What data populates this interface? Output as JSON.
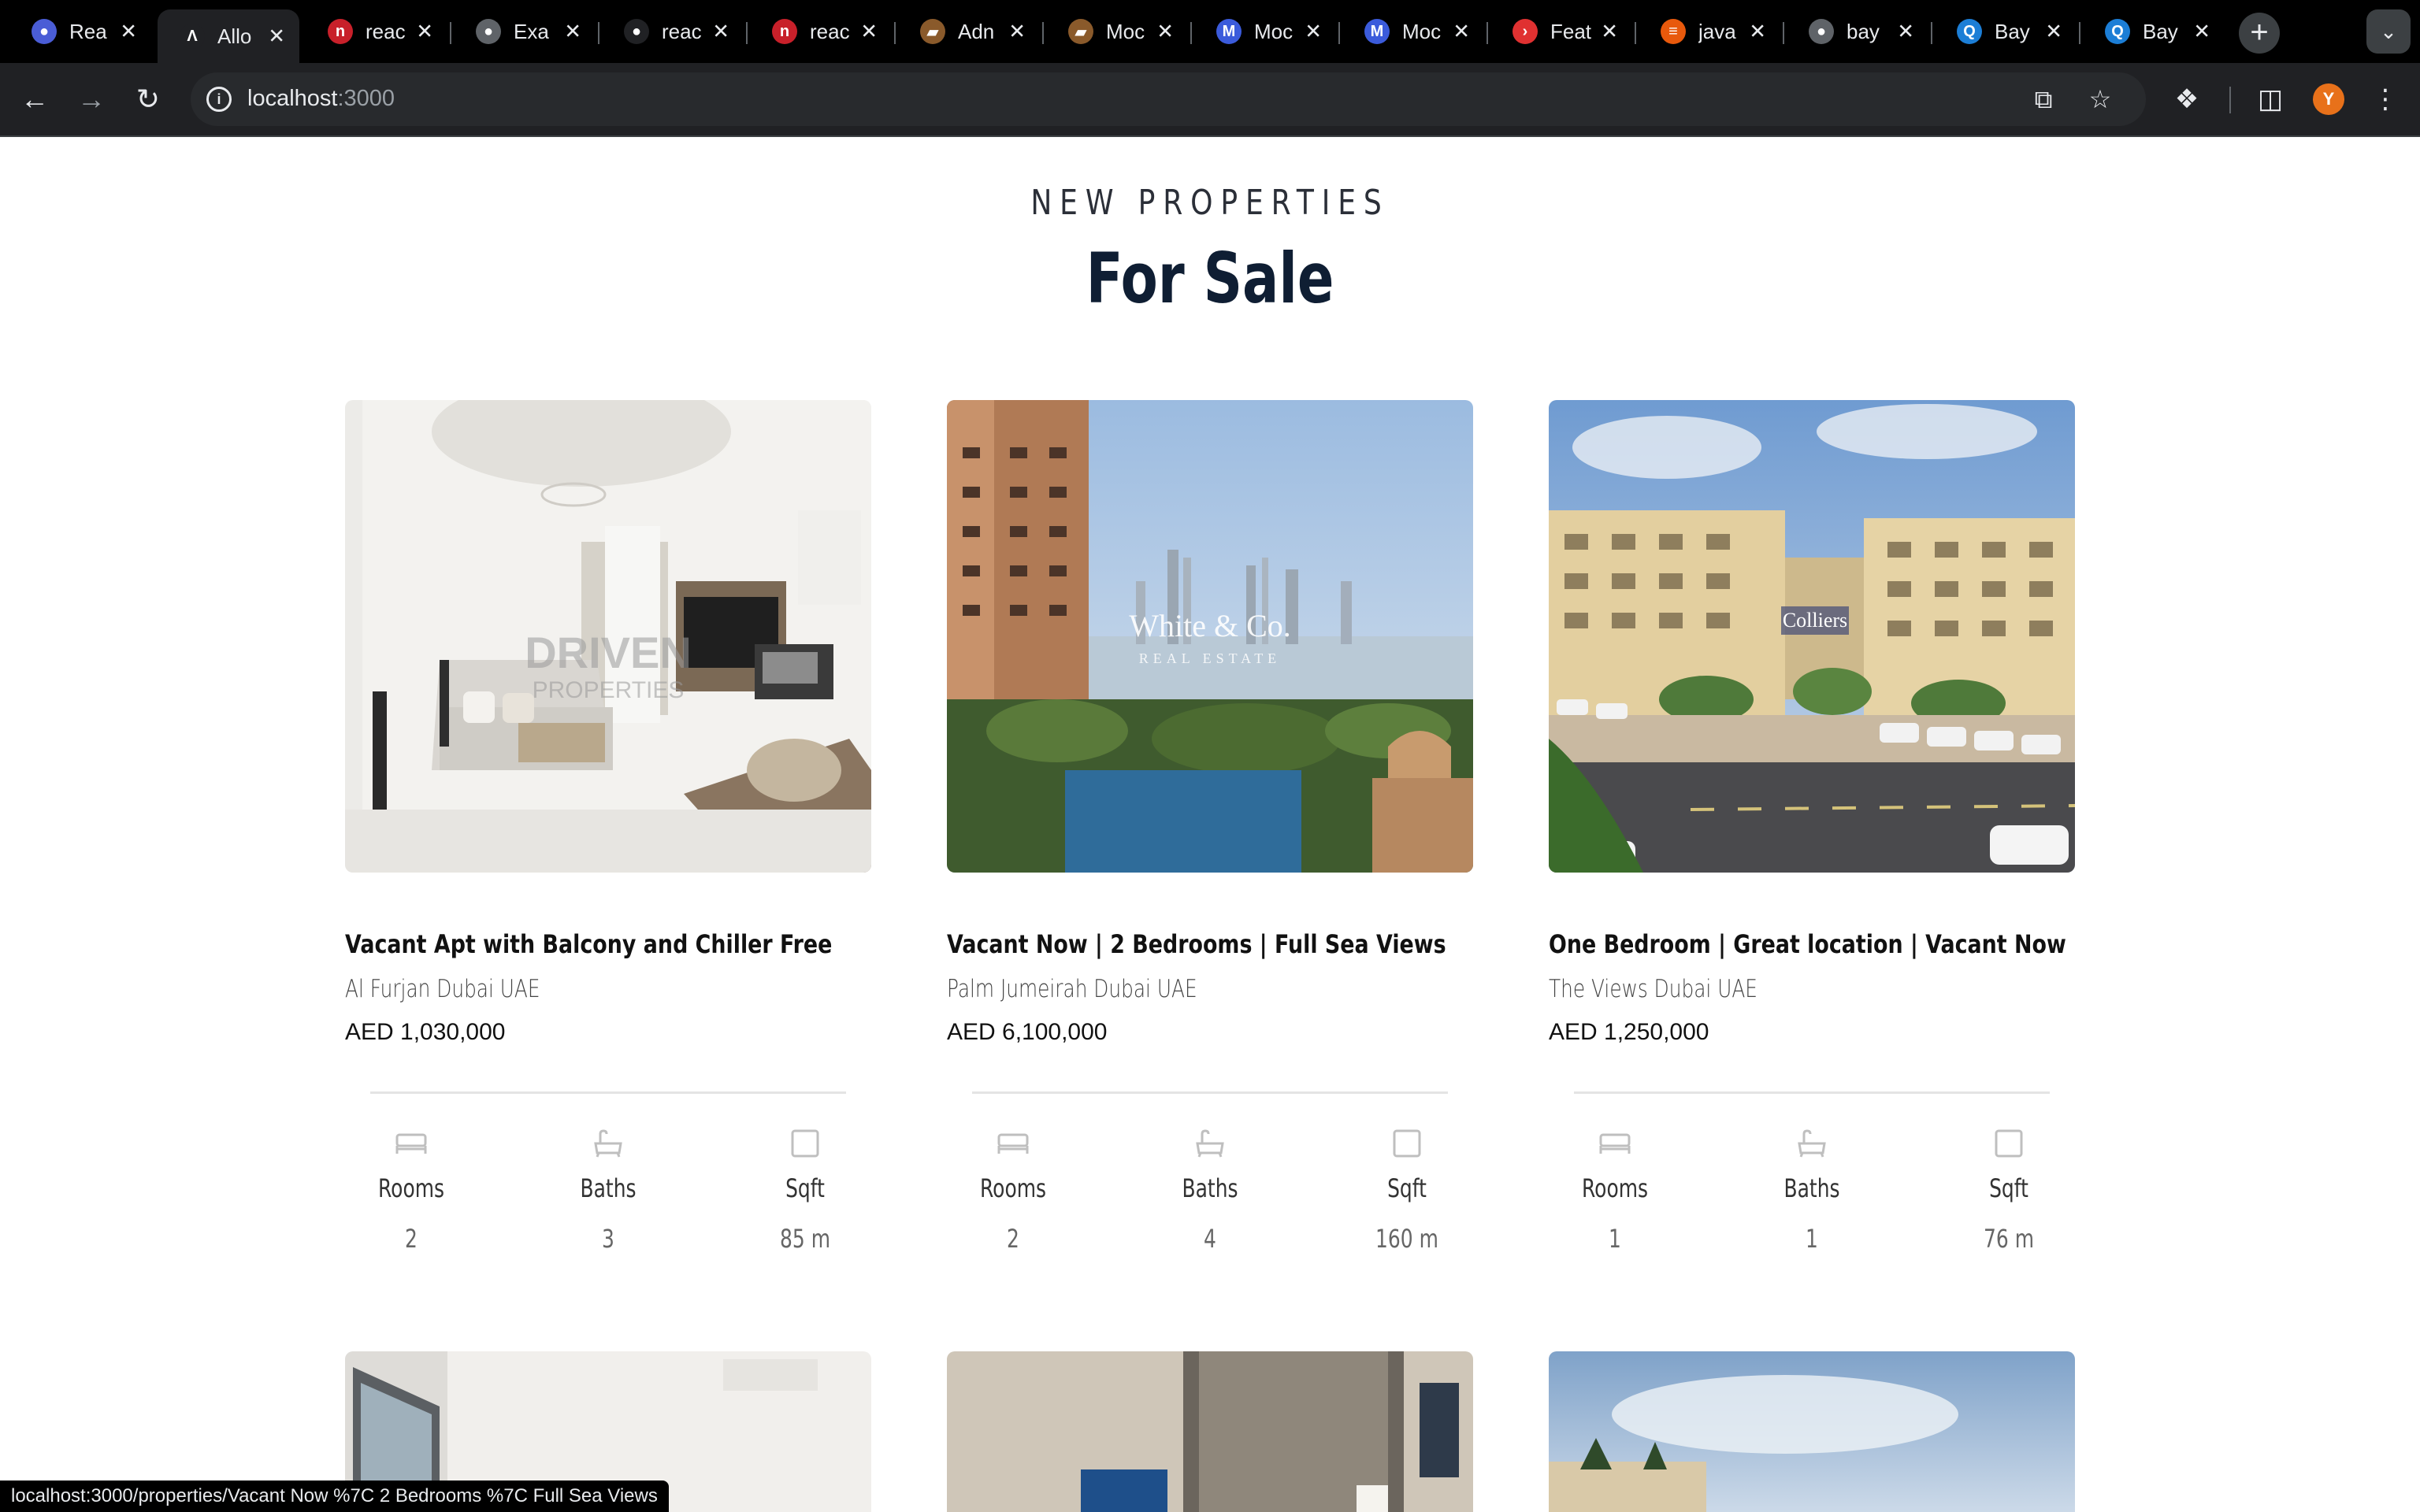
{
  "browser": {
    "tabs": [
      {
        "title": "Rea",
        "fav_color": "#4a5dd6",
        "fav_text": "●"
      },
      {
        "title": "Allo",
        "fav_color": "#202124",
        "fav_text": "Λ"
      },
      {
        "title": "reac",
        "fav_color": "#c8202a",
        "fav_text": "n"
      },
      {
        "title": "Exa",
        "fav_color": "#5f6368",
        "fav_text": "●"
      },
      {
        "title": "reac",
        "fav_color": "#202124",
        "fav_text": "●"
      },
      {
        "title": "reac",
        "fav_color": "#c8202a",
        "fav_text": "n"
      },
      {
        "title": "Adn",
        "fav_color": "#8a5a2b",
        "fav_text": "▰"
      },
      {
        "title": "Moc",
        "fav_color": "#8a5a2b",
        "fav_text": "▰"
      },
      {
        "title": "Moc",
        "fav_color": "#3b5bdb",
        "fav_text": "M"
      },
      {
        "title": "Moc",
        "fav_color": "#3b5bdb",
        "fav_text": "M"
      },
      {
        "title": "Feat",
        "fav_color": "#e03131",
        "fav_text": "›"
      },
      {
        "title": "java",
        "fav_color": "#e8590c",
        "fav_text": "≡"
      },
      {
        "title": "bay",
        "fav_color": "#5f6368",
        "fav_text": "●"
      },
      {
        "title": "Bay",
        "fav_color": "#1c7ed6",
        "fav_text": "Q"
      },
      {
        "title": "Bay",
        "fav_color": "#1c7ed6",
        "fav_text": "Q"
      }
    ],
    "active_tab_index": 1,
    "address": {
      "host": "localhost",
      "port": ":3000"
    },
    "profile_initial": "Y",
    "status_url": "localhost:3000/properties/Vacant Now %7C 2 Bedrooms %7C Full Sea Views"
  },
  "section": {
    "eyebrow": "NEW PROPERTIES",
    "title": "For Sale"
  },
  "feature_labels": {
    "rooms": "Rooms",
    "baths": "Baths",
    "sqft": "Sqft"
  },
  "properties": [
    {
      "title": "Vacant Apt with Balcony and Chiller Free",
      "location": "Al Furjan Dubai UAE",
      "price": "AED 1,030,000",
      "rooms": "2",
      "baths": "3",
      "sqft": "85 m",
      "watermark": "DRIVEN",
      "watermark_sub": "PROPERTIES"
    },
    {
      "title": "Vacant Now | 2 Bedrooms | Full Sea Views",
      "location": "Palm Jumeirah Dubai UAE",
      "price": "AED 6,100,000",
      "rooms": "2",
      "baths": "4",
      "sqft": "160 m",
      "watermark": "White & Co.",
      "watermark_sub": "REAL ESTATE"
    },
    {
      "title": "One Bedroom | Great location | Vacant Now",
      "location": "The Views Dubai UAE",
      "price": "AED 1,250,000",
      "rooms": "1",
      "baths": "1",
      "sqft": "76 m",
      "watermark": "Colliers",
      "watermark_sub": ""
    }
  ],
  "colors": {
    "heading": "#0f1e33",
    "divider": "#e4e4e4",
    "icon": "#bfbfbf"
  }
}
